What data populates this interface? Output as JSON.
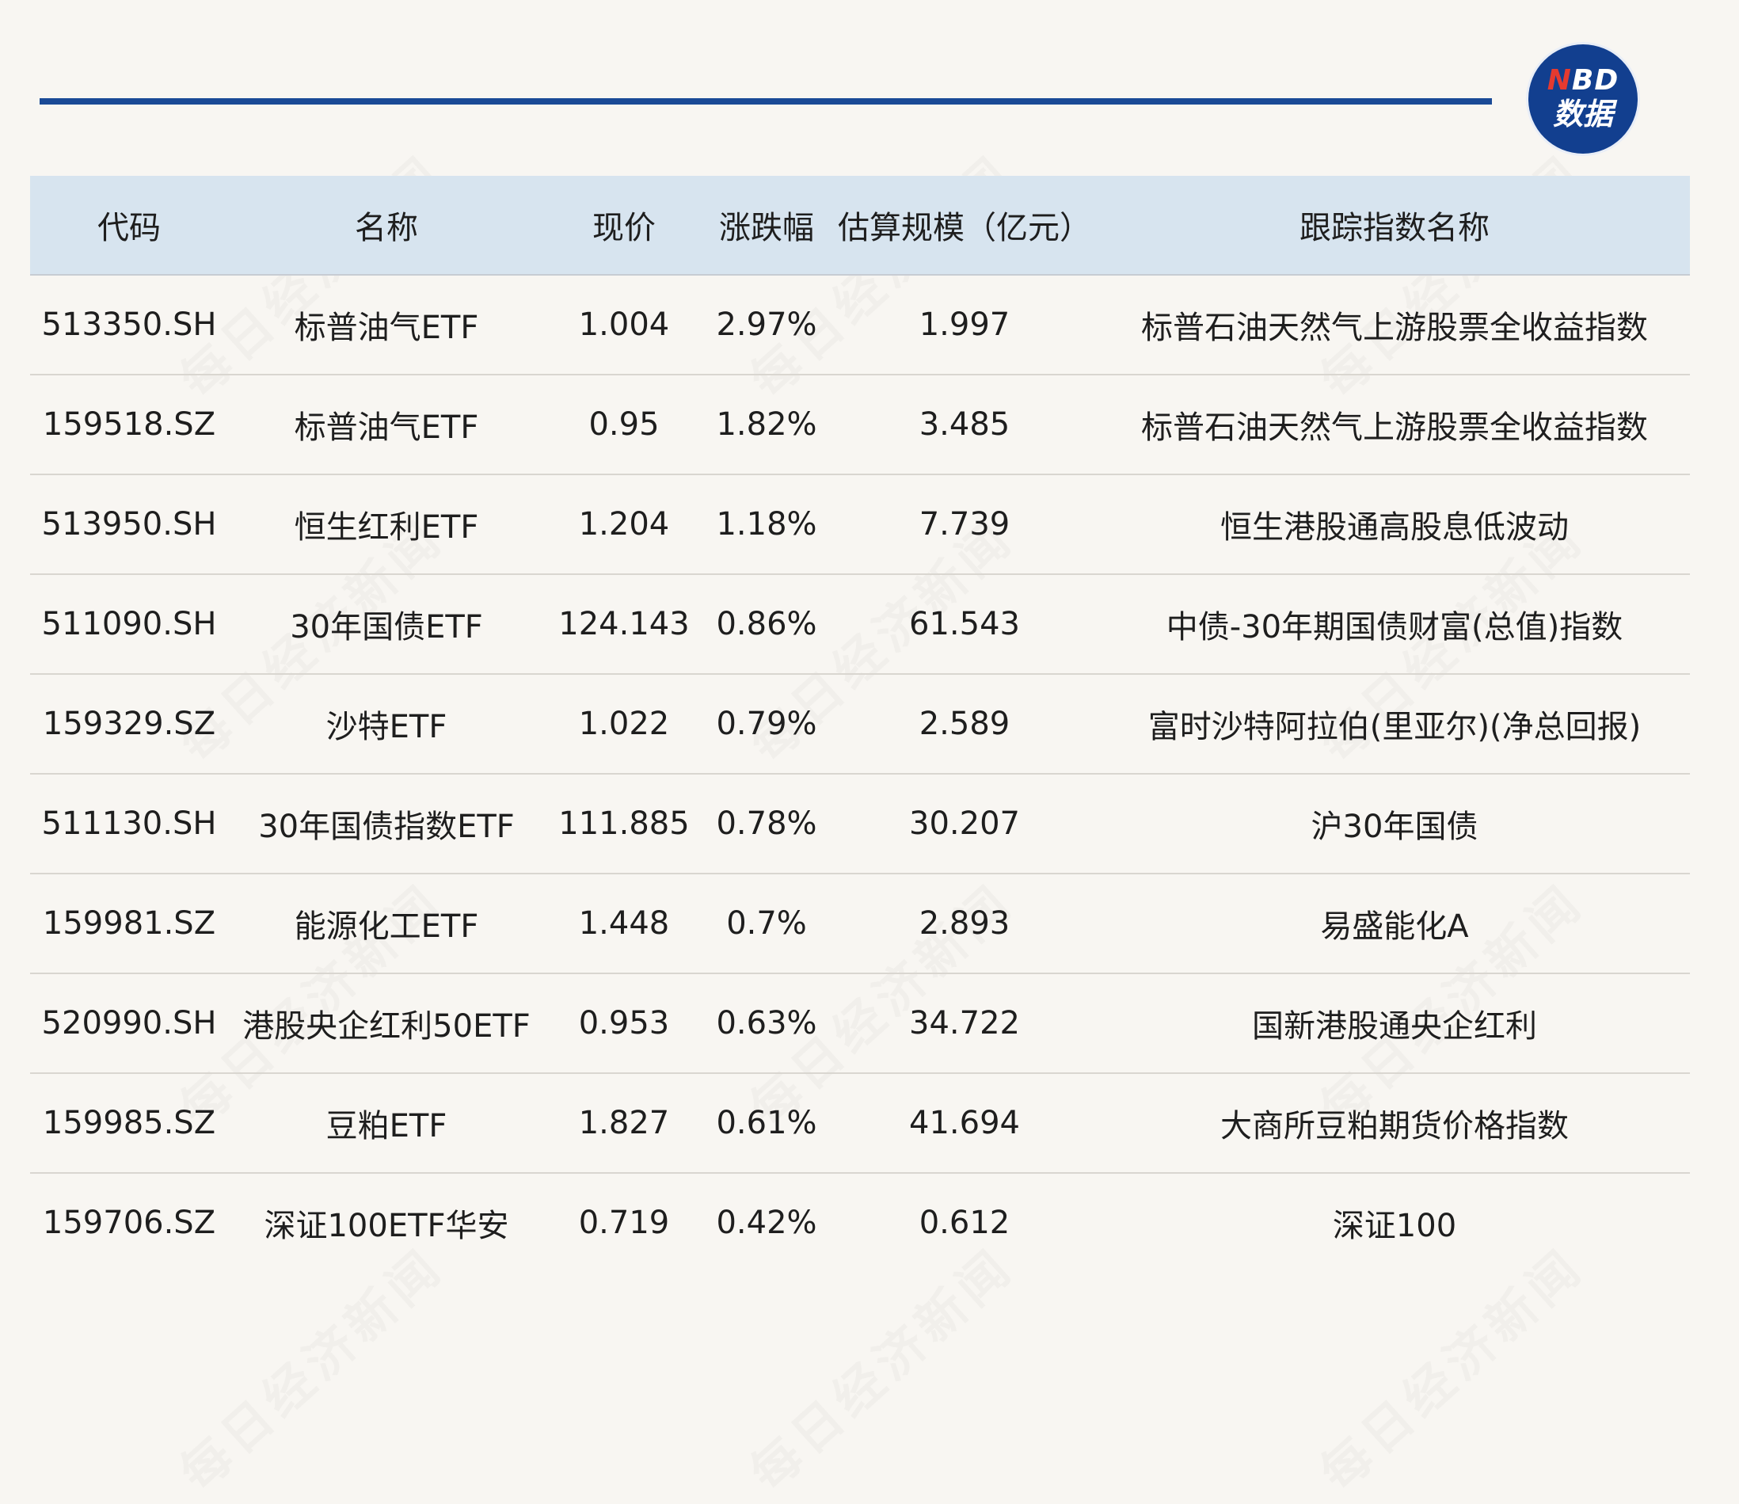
{
  "logo": {
    "line1_n": "N",
    "line1_rest": "BD",
    "line2": "数据",
    "colors": {
      "circle": "#123f8f",
      "n": "#e53a2f"
    }
  },
  "watermark": "每日经济新闻",
  "colors": {
    "rule": "#1a4a96",
    "header_bg": "#d7e4ef",
    "page_bg": "#f8f6f2"
  },
  "table": {
    "headers": [
      "代码",
      "名称",
      "现价",
      "涨跌幅",
      "估算规模（亿元）",
      "跟踪指数名称"
    ],
    "rows": [
      [
        "513350.SH",
        "标普油气ETF",
        "1.004",
        "2.97%",
        "1.997",
        "标普石油天然气上游股票全收益指数"
      ],
      [
        "159518.SZ",
        "标普油气ETF",
        "0.95",
        "1.82%",
        "3.485",
        "标普石油天然气上游股票全收益指数"
      ],
      [
        "513950.SH",
        "恒生红利ETF",
        "1.204",
        "1.18%",
        "7.739",
        "恒生港股通高股息低波动"
      ],
      [
        "511090.SH",
        "30年国债ETF",
        "124.143",
        "0.86%",
        "61.543",
        "中债-30年期国债财富(总值)指数"
      ],
      [
        "159329.SZ",
        "沙特ETF",
        "1.022",
        "0.79%",
        "2.589",
        "富时沙特阿拉伯(里亚尔)(净总回报)"
      ],
      [
        "511130.SH",
        "30年国债指数ETF",
        "111.885",
        "0.78%",
        "30.207",
        "沪30年国债"
      ],
      [
        "159981.SZ",
        "能源化工ETF",
        "1.448",
        "0.7%",
        "2.893",
        "易盛能化A"
      ],
      [
        "520990.SH",
        "港股央企红利50ETF",
        "0.953",
        "0.63%",
        "34.722",
        "国新港股通央企红利"
      ],
      [
        "159985.SZ",
        "豆粕ETF",
        "1.827",
        "0.61%",
        "41.694",
        "大商所豆粕期货价格指数"
      ],
      [
        "159706.SZ",
        "深证100ETF华安",
        "0.719",
        "0.42%",
        "0.612",
        "深证100"
      ]
    ]
  }
}
